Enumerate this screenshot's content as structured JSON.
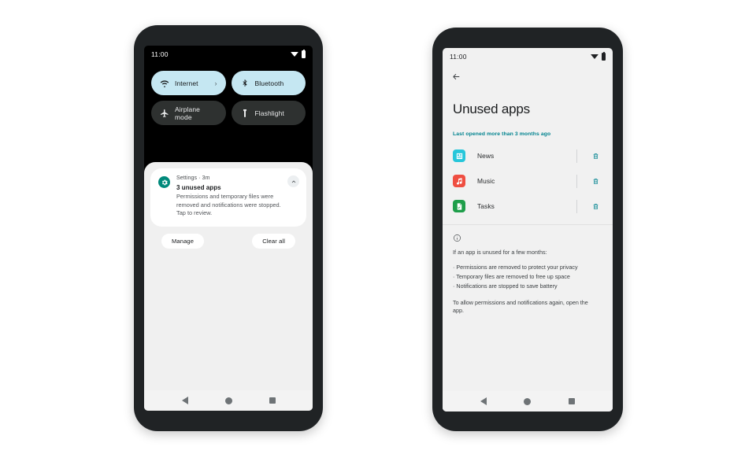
{
  "left_phone": {
    "status_bar": {
      "time": "11:00",
      "wifi_icon": "wifi-icon",
      "battery_icon": "battery-icon"
    },
    "quick_settings": {
      "tiles": [
        {
          "label": "Internet",
          "icon": "wifi-icon",
          "state": "on",
          "has_chevron": true,
          "chevron": "›"
        },
        {
          "label": "Bluetooth",
          "icon": "bluetooth-icon",
          "state": "on",
          "has_chevron": false
        },
        {
          "label": "Airplane mode",
          "icon": "airplane-icon",
          "state": "off",
          "has_chevron": false
        },
        {
          "label": "Flashlight",
          "icon": "flashlight-icon",
          "state": "off",
          "has_chevron": false
        }
      ],
      "on_color": "#c5e7f2",
      "off_color": "#2e3130"
    },
    "notification": {
      "app_icon": "settings-gear-icon",
      "app_icon_color": "#00897b",
      "source": "Settings · 3m",
      "title": "3 unused apps",
      "body": "Permissions and temporary files were removed and notifications were stopped. Tap to review.",
      "collapse_icon": "chevron-up-icon"
    },
    "actions": {
      "manage": "Manage",
      "clear_all": "Clear all"
    },
    "nav_bar": {
      "back": "back-icon",
      "home": "home-icon",
      "recents": "recents-icon"
    }
  },
  "right_phone": {
    "status_bar": {
      "time": "11:00",
      "wifi_icon": "wifi-icon",
      "battery_icon": "battery-icon"
    },
    "back_icon": "back-arrow-icon",
    "title": "Unused apps",
    "section_label": "Last opened more than 3 months ago",
    "accent_color": "#00838f",
    "apps": [
      {
        "name": "News",
        "icon": "news-icon",
        "icon_color": "#26c6da",
        "delete_icon": "trash-icon"
      },
      {
        "name": "Music",
        "icon": "music-note-icon",
        "icon_color": "#ef4e41",
        "delete_icon": "trash-icon"
      },
      {
        "name": "Tasks",
        "icon": "tasks-document-icon",
        "icon_color": "#1e9e4a",
        "delete_icon": "trash-icon"
      }
    ],
    "info": {
      "icon": "info-circle-icon",
      "lead": "If an app is unused for a few months:",
      "bullets": [
        "· Permissions are removed to protect your privacy",
        "· Temporary files are removed to free up space",
        "· Notifications are stopped to save battery"
      ],
      "footer": "To allow permissions and notifications again, open the app."
    },
    "nav_bar": {
      "back": "back-icon",
      "home": "home-icon",
      "recents": "recents-icon"
    }
  }
}
